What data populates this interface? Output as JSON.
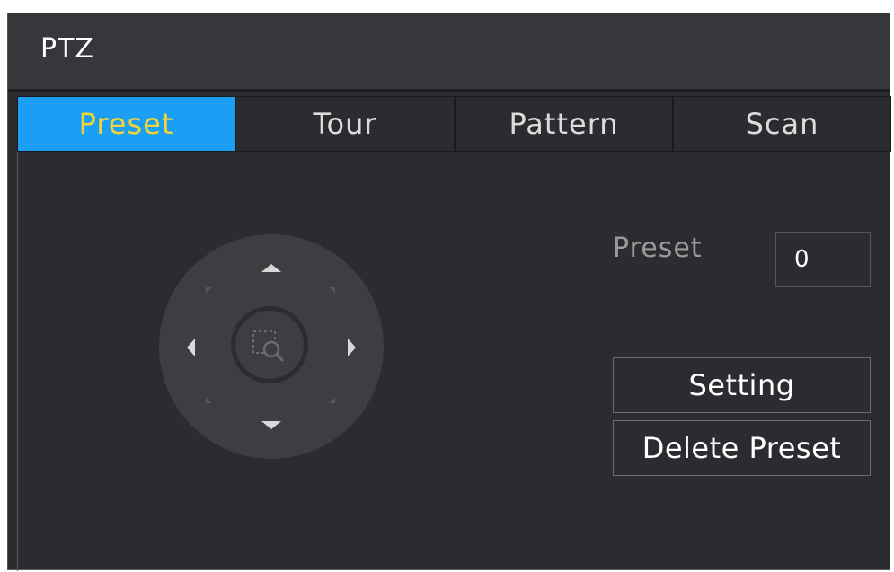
{
  "window": {
    "title": "PTZ"
  },
  "tabs": [
    {
      "label": "Preset",
      "active": true
    },
    {
      "label": "Tour",
      "active": false
    },
    {
      "label": "Pattern",
      "active": false
    },
    {
      "label": "Scan",
      "active": false
    }
  ],
  "preset_panel": {
    "preset_label": "Preset",
    "preset_value": "0",
    "setting_button": "Setting",
    "delete_button": "Delete Preset"
  },
  "ptz_control": {
    "icons": [
      "arrow-up-icon",
      "arrow-down-icon",
      "arrow-left-icon",
      "arrow-right-icon",
      "zoom-area-icon"
    ]
  },
  "colors": {
    "background": "#2b2c30",
    "title_bar": "#36373b",
    "active_tab": "#1a9ff4",
    "active_tab_text": "#f5d336",
    "pad": "#3d3e42"
  }
}
